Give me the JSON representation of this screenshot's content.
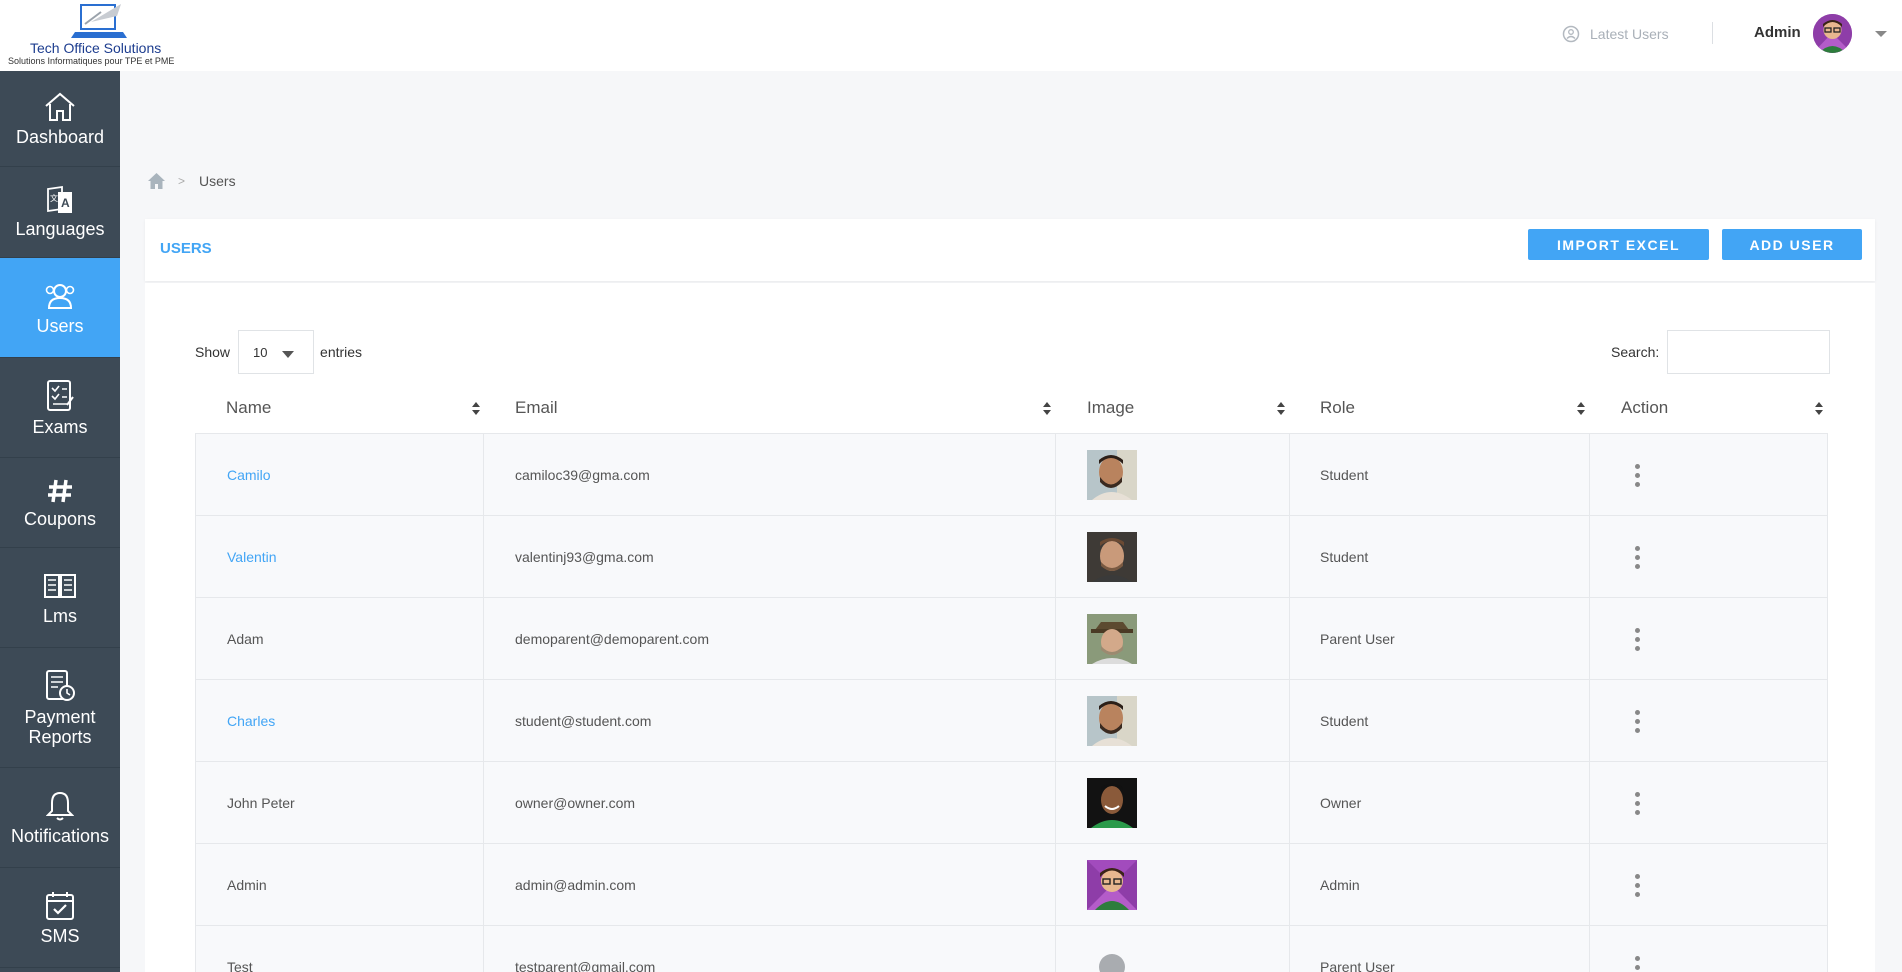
{
  "brand": {
    "title": "Tech Office Solutions",
    "subtitle": "Solutions Informatiques pour TPE et PME"
  },
  "topbar": {
    "latest_users": "Latest Users",
    "admin_name": "Admin"
  },
  "sidebar": {
    "items": [
      {
        "label": "Dashboard",
        "icon": "home-icon",
        "active": false
      },
      {
        "label": "Languages",
        "icon": "translate-icon",
        "active": false
      },
      {
        "label": "Users",
        "icon": "users-icon",
        "active": true
      },
      {
        "label": "Exams",
        "icon": "exam-icon",
        "active": false
      },
      {
        "label": "Coupons",
        "icon": "hashtag-icon",
        "active": false
      },
      {
        "label": "Lms",
        "icon": "book-icon",
        "active": false
      },
      {
        "label": "Payment Reports",
        "icon": "report-icon",
        "active": false
      },
      {
        "label": "Notifications",
        "icon": "bell-icon",
        "active": false
      },
      {
        "label": "SMS",
        "icon": "calendar-check-icon",
        "active": false
      }
    ]
  },
  "breadcrumb": {
    "current": "Users"
  },
  "header": {
    "title": "USERS",
    "import_label": "IMPORT EXCEL",
    "add_label": "ADD USER"
  },
  "table_controls": {
    "show_label": "Show",
    "entries_value": "10",
    "entries_label": "entries",
    "search_label": "Search:"
  },
  "table": {
    "columns": [
      "Name",
      "Email",
      "Image",
      "Role",
      "Action"
    ],
    "rows": [
      {
        "name": "Camilo",
        "email": "camiloc39@gma.com",
        "role": "Student",
        "link": true
      },
      {
        "name": "Valentin",
        "email": "valentinj93@gma.com",
        "role": "Student",
        "link": true
      },
      {
        "name": "Adam",
        "email": "demoparent@demoparent.com",
        "role": "Parent User",
        "link": false
      },
      {
        "name": "Charles",
        "email": "student@student.com",
        "role": "Student",
        "link": true
      },
      {
        "name": "John Peter",
        "email": "owner@owner.com",
        "role": "Owner",
        "link": false
      },
      {
        "name": "Admin",
        "email": "admin@admin.com",
        "role": "Admin",
        "link": false
      },
      {
        "name": "Test",
        "email": "testparent@gmail.com",
        "role": "Parent User",
        "link": false
      }
    ]
  },
  "colors": {
    "accent": "#42a5f5",
    "sidebar": "#3d4a56"
  }
}
